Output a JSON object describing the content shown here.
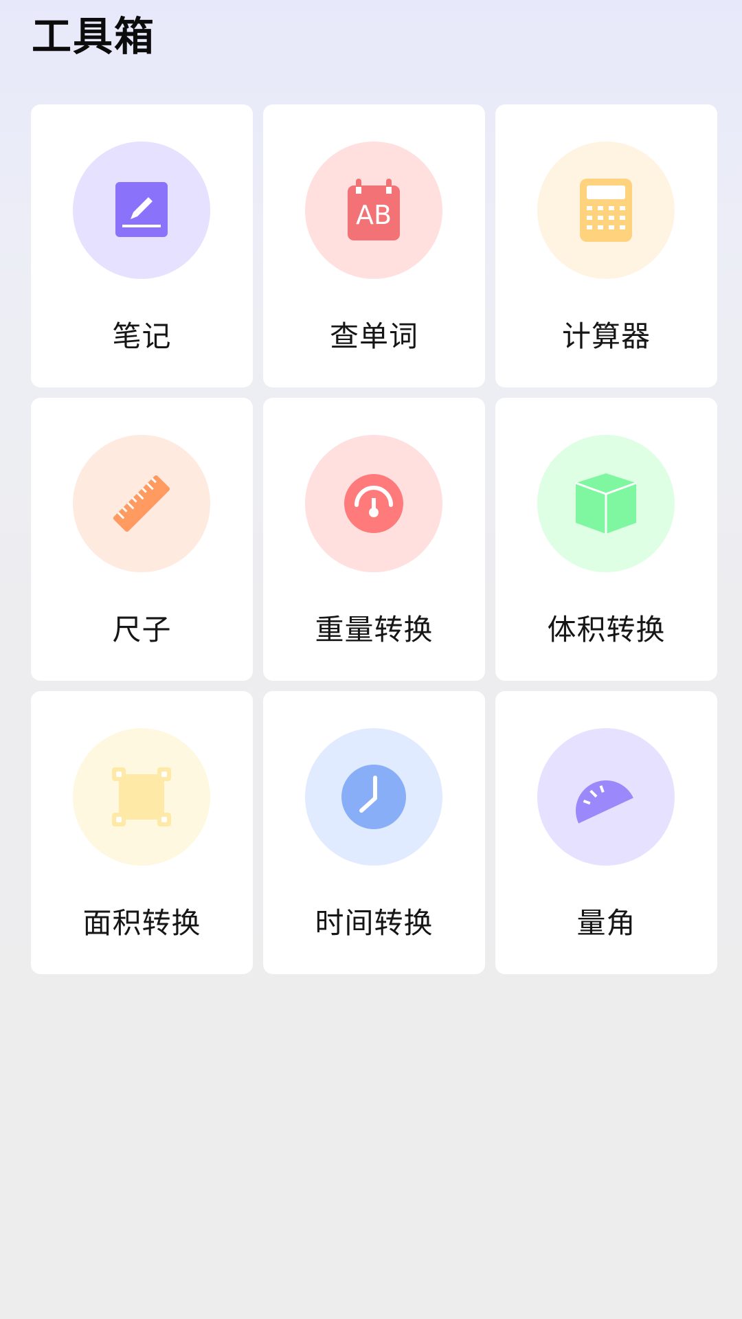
{
  "header": {
    "title": "工具箱"
  },
  "tools": [
    {
      "label": "笔记",
      "icon": "notebook-pencil-icon",
      "color": "#8a72fb",
      "bg": "#e5e1ff"
    },
    {
      "label": "查单词",
      "icon": "ab-calendar-icon",
      "color": "#f27275",
      "bg": "#ffe0df"
    },
    {
      "label": "计算器",
      "icon": "calculator-icon",
      "color": "#ffd37e",
      "bg": "#fff4e1"
    },
    {
      "label": "尺子",
      "icon": "ruler-icon",
      "color": "#ff9b61",
      "bg": "#ffeae0"
    },
    {
      "label": "重量转换",
      "icon": "scale-gauge-icon",
      "color": "#ff7a7a",
      "bg": "#ffe0df"
    },
    {
      "label": "体积转换",
      "icon": "cube-icon",
      "color": "#7ff7a0",
      "bg": "#dfffe4"
    },
    {
      "label": "面积转换",
      "icon": "area-square-icon",
      "color": "#ffe9a6",
      "bg": "#fff8e0"
    },
    {
      "label": "时间转换",
      "icon": "clock-icon",
      "color": "#88aef8",
      "bg": "#e1ebff"
    },
    {
      "label": "量角",
      "icon": "protractor-icon",
      "color": "#9b88fb",
      "bg": "#e5e1ff"
    }
  ]
}
